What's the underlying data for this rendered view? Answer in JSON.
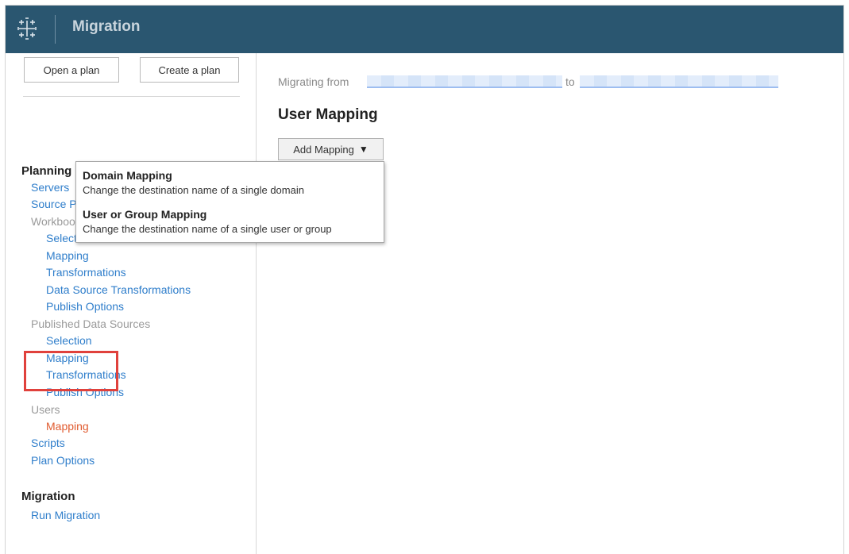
{
  "header": {
    "app_title": "Migration",
    "logo_icon": "tableau-logo-icon"
  },
  "sidebar": {
    "open_plan_label": "Open a plan",
    "create_plan_label": "Create a plan",
    "planning_heading": "Planning",
    "items": [
      {
        "label": "Servers",
        "kind": "link"
      },
      {
        "label": "Source Projects",
        "kind": "link"
      },
      {
        "label": "Workbooks",
        "kind": "group"
      },
      {
        "label": "Selection",
        "kind": "link"
      },
      {
        "label": "Mapping",
        "kind": "link"
      },
      {
        "label": "Transformations",
        "kind": "link"
      },
      {
        "label": "Data Source Transformations",
        "kind": "link"
      },
      {
        "label": "Publish Options",
        "kind": "link"
      },
      {
        "label": "Published Data Sources",
        "kind": "group"
      },
      {
        "label": "Selection",
        "kind": "link"
      },
      {
        "label": "Mapping",
        "kind": "link"
      },
      {
        "label": "Transformations",
        "kind": "link"
      },
      {
        "label": "Publish Options",
        "kind": "link"
      },
      {
        "label": "Users",
        "kind": "group"
      },
      {
        "label": "Mapping",
        "kind": "active"
      },
      {
        "label": "Scripts",
        "kind": "link"
      },
      {
        "label": "Plan Options",
        "kind": "link"
      }
    ],
    "migration_heading": "Migration",
    "run_migration_label": "Run Migration"
  },
  "main": {
    "migrating_from_label": "Migrating from",
    "to_label": "to",
    "title": "User Mapping",
    "add_mapping_label": "Add Mapping"
  },
  "dropdown": {
    "items": [
      {
        "title": "Domain Mapping",
        "description": "Change the destination name of a single domain"
      },
      {
        "title": "User or Group Mapping",
        "description": "Change the destination name of a single user or group"
      }
    ]
  },
  "colors": {
    "header": "#2a5670",
    "link": "#2f7ecb",
    "active": "#e05a2e",
    "highlight": "#e0413c"
  }
}
